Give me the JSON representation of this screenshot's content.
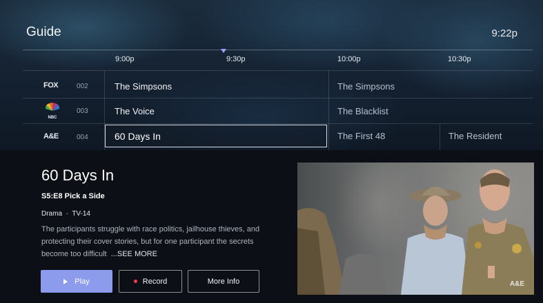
{
  "header": {
    "title": "Guide",
    "clock": "9:22p"
  },
  "timeslots": [
    "9:00p",
    "9:30p",
    "10:00p",
    "10:30p"
  ],
  "channels": [
    {
      "logo": "FOX",
      "number": "002",
      "programs": [
        {
          "title": "The Simpsons"
        },
        {
          "title": "The Simpsons"
        }
      ]
    },
    {
      "logo": "NBC",
      "number": "003",
      "programs": [
        {
          "title": "The Voice"
        },
        {
          "title": "The Blacklist"
        }
      ]
    },
    {
      "logo": "A&E",
      "number": "004",
      "programs": [
        {
          "title": "60 Days In"
        },
        {
          "title": "The First 48"
        },
        {
          "title": "The Resident"
        }
      ]
    }
  ],
  "details": {
    "title": "60 Days In",
    "episode": "S5:E8 Pick a Side",
    "genre": "Drama",
    "separator": "·",
    "rating": "TV-14",
    "description": "The participants struggle with race politics, jailhouse thieves, and protecting their cover stories, but for one participant the secrets become too difficult",
    "see_more": "...SEE MORE",
    "buttons": {
      "play": "Play",
      "record": "Record",
      "more_info": "More Info"
    },
    "preview_bug": "A&E"
  },
  "colors": {
    "accent": "#8d9bec",
    "record_dot": "#ff3b4a",
    "now_marker": "#9aa6ff"
  }
}
